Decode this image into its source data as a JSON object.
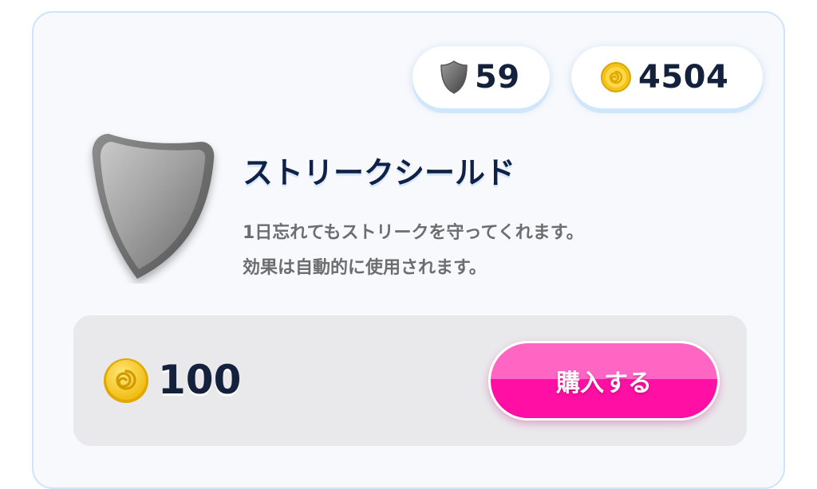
{
  "currency": {
    "shields_owned": "59",
    "coins": "4504"
  },
  "item": {
    "title": "ストリークシールド",
    "description_line1": "1日忘れてもストリークを守ってくれます。",
    "description_line2": "効果は自動的に使用されます。",
    "icon": "shield-icon"
  },
  "purchase": {
    "price": "100",
    "price_icon": "coin-icon",
    "button_label": "購入する"
  },
  "colors": {
    "accent_pink": "#ff0fa3",
    "accent_pink_light": "#ff66c4",
    "title_navy": "#0f2147",
    "card_border": "#cfe3fb",
    "coin_gold": "#f2c418"
  }
}
